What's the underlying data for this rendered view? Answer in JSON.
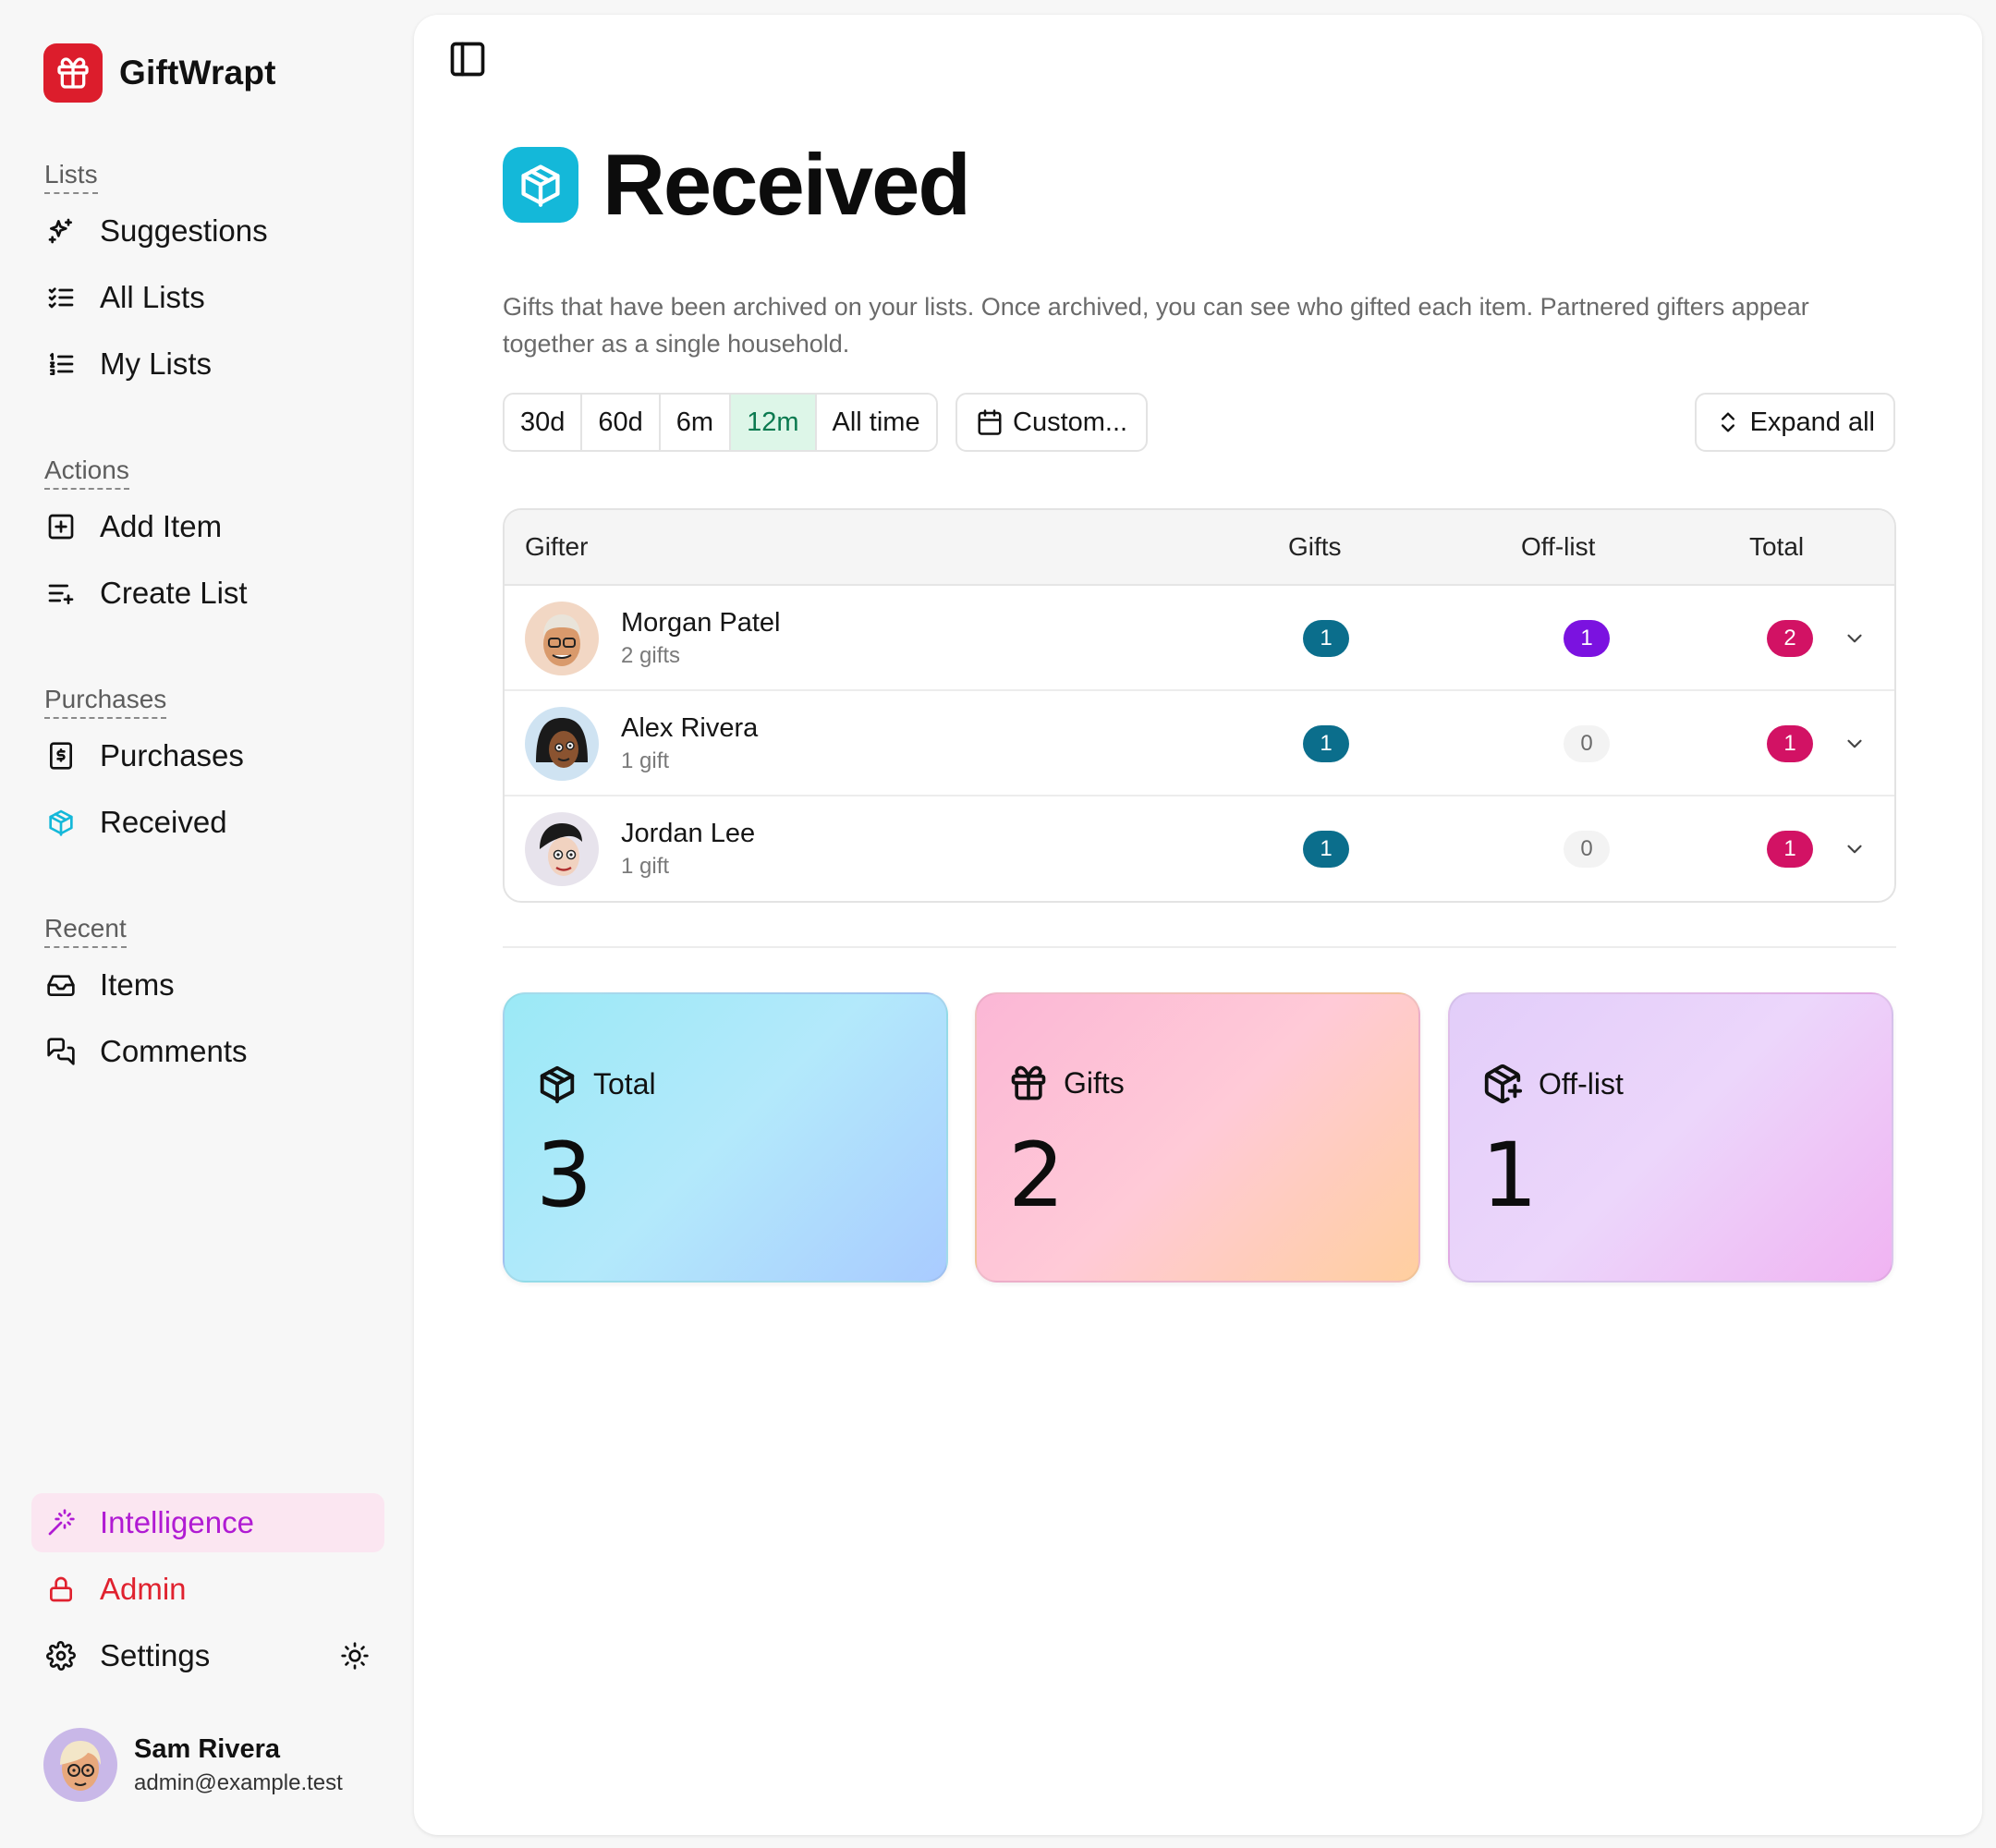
{
  "app": {
    "name": "GiftWrapt"
  },
  "sidebar": {
    "sections": [
      {
        "heading": "Lists",
        "items": [
          {
            "label": "Suggestions",
            "icon": "sparkles-icon"
          },
          {
            "label": "All Lists",
            "icon": "list-checks-icon"
          },
          {
            "label": "My Lists",
            "icon": "list-ordered-icon"
          }
        ]
      },
      {
        "heading": "Actions",
        "items": [
          {
            "label": "Add Item",
            "icon": "plus-square-icon"
          },
          {
            "label": "Create List",
            "icon": "list-plus-icon"
          }
        ]
      },
      {
        "heading": "Purchases",
        "items": [
          {
            "label": "Purchases",
            "icon": "receipt-icon"
          },
          {
            "label": "Received",
            "icon": "package-open-icon"
          }
        ]
      },
      {
        "heading": "Recent",
        "items": [
          {
            "label": "Items",
            "icon": "inbox-icon"
          },
          {
            "label": "Comments",
            "icon": "messages-icon"
          }
        ]
      }
    ],
    "footer_items": {
      "intelligence": "Intelligence",
      "admin": "Admin",
      "settings": "Settings"
    },
    "user": {
      "name": "Sam Rivera",
      "email": "admin@example.test"
    }
  },
  "page": {
    "title": "Received",
    "description": "Gifts that have been archived on your lists. Once archived, you can see who gifted each item. Partnered gifters appear together as a single household."
  },
  "filters": {
    "ranges": [
      "30d",
      "60d",
      "6m",
      "12m",
      "All time"
    ],
    "active_range": "12m",
    "custom_label": "Custom...",
    "expand_label": "Expand all"
  },
  "table": {
    "headers": {
      "gifter": "Gifter",
      "gifts": "Gifts",
      "offlist": "Off-list",
      "total": "Total"
    },
    "rows": [
      {
        "name": "Morgan Patel",
        "sub": "2 gifts",
        "gifts": "1",
        "offlist": "1",
        "total": "2"
      },
      {
        "name": "Alex Rivera",
        "sub": "1 gift",
        "gifts": "1",
        "offlist": "0",
        "total": "1"
      },
      {
        "name": "Jordan Lee",
        "sub": "1 gift",
        "gifts": "1",
        "offlist": "0",
        "total": "1"
      }
    ]
  },
  "stats": {
    "total": {
      "label": "Total",
      "value": "3"
    },
    "gifts": {
      "label": "Gifts",
      "value": "2"
    },
    "offlist": {
      "label": "Off-list",
      "value": "1"
    }
  },
  "colors": {
    "brand": "#dc1d2c",
    "page_icon": "#14b8d9",
    "active_range_bg": "#ddf6e8",
    "badge_gifts": "#0b6e8c",
    "badge_offlist": "#7b12e0",
    "badge_total": "#d21264",
    "intelligence": "#b01bd3",
    "admin": "#e0222f"
  }
}
